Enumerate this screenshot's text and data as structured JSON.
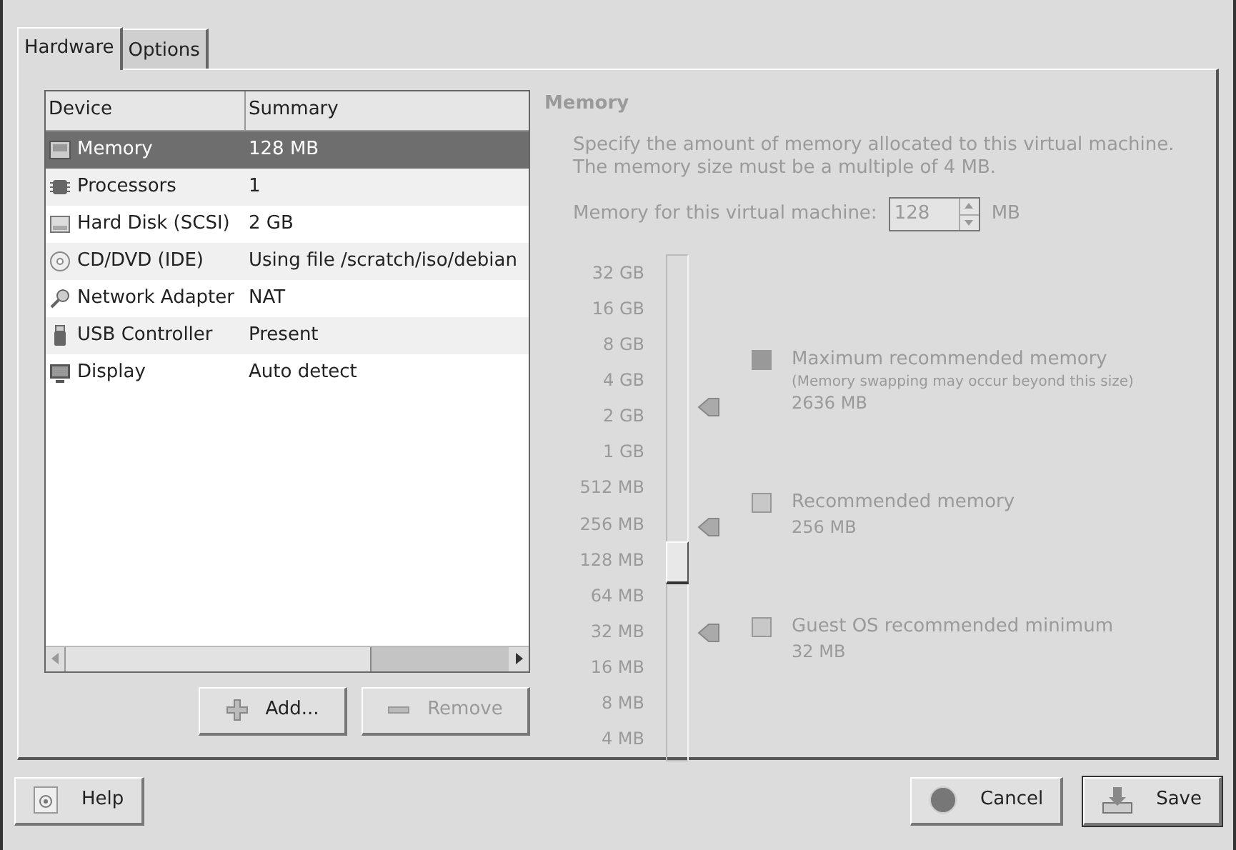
{
  "tabs": [
    {
      "label": "Hardware",
      "selected": true
    },
    {
      "label": "Options",
      "selected": false
    }
  ],
  "device_table": {
    "columns": [
      "Device",
      "Summary"
    ],
    "rows": [
      {
        "kind": "memory",
        "device": "Memory",
        "summary": "128 MB",
        "selected": true
      },
      {
        "kind": "cpu",
        "device": "Processors",
        "summary": "1",
        "selected": false
      },
      {
        "kind": "disk",
        "device": "Hard Disk (SCSI)",
        "summary": "2 GB",
        "selected": false
      },
      {
        "kind": "cdrom",
        "device": "CD/DVD (IDE)",
        "summary": "Using file /scratch/iso/debian",
        "selected": false
      },
      {
        "kind": "network",
        "device": "Network Adapter",
        "summary": "NAT",
        "selected": false
      },
      {
        "kind": "usb",
        "device": "USB Controller",
        "summary": "Present",
        "selected": false
      },
      {
        "kind": "display",
        "device": "Display",
        "summary": "Auto detect",
        "selected": false
      }
    ]
  },
  "list_buttons": [
    {
      "label": "Add...",
      "kind": "add",
      "disabled": false
    },
    {
      "label": "Remove",
      "kind": "remove",
      "disabled": true
    }
  ],
  "memory": {
    "title": "Memory",
    "disabled": true,
    "description": "Specify the amount of memory allocated to this virtual machine.\nThe memory size must be a multiple of 4 MB.",
    "field_label": "Memory for this virtual machine:",
    "value": "128",
    "unit": "MB",
    "slider": {
      "level": 0.38,
      "ticks": [
        "32 GB",
        "16 GB",
        "8 GB",
        "4 GB",
        "2 GB",
        "1 GB",
        "512 MB",
        "256 MB",
        "128 MB",
        "64 MB",
        "32 MB",
        "16 MB",
        "8 MB",
        "4 MB"
      ]
    },
    "recommendations": [
      {
        "label": "Maximum recommended memory",
        "note": "(Memory swapping may occur beyond this size)",
        "value": "2636 MB"
      },
      {
        "label": "Recommended memory",
        "value": "256 MB"
      },
      {
        "label": "Guest OS recommended minimum",
        "value": "32 MB"
      }
    ]
  },
  "footer_buttons": [
    {
      "label": "Help",
      "kind": "help",
      "default": false
    },
    {
      "label": "Cancel",
      "kind": "cancel",
      "default": false
    },
    {
      "label": "Save",
      "kind": "save",
      "default": true
    }
  ]
}
